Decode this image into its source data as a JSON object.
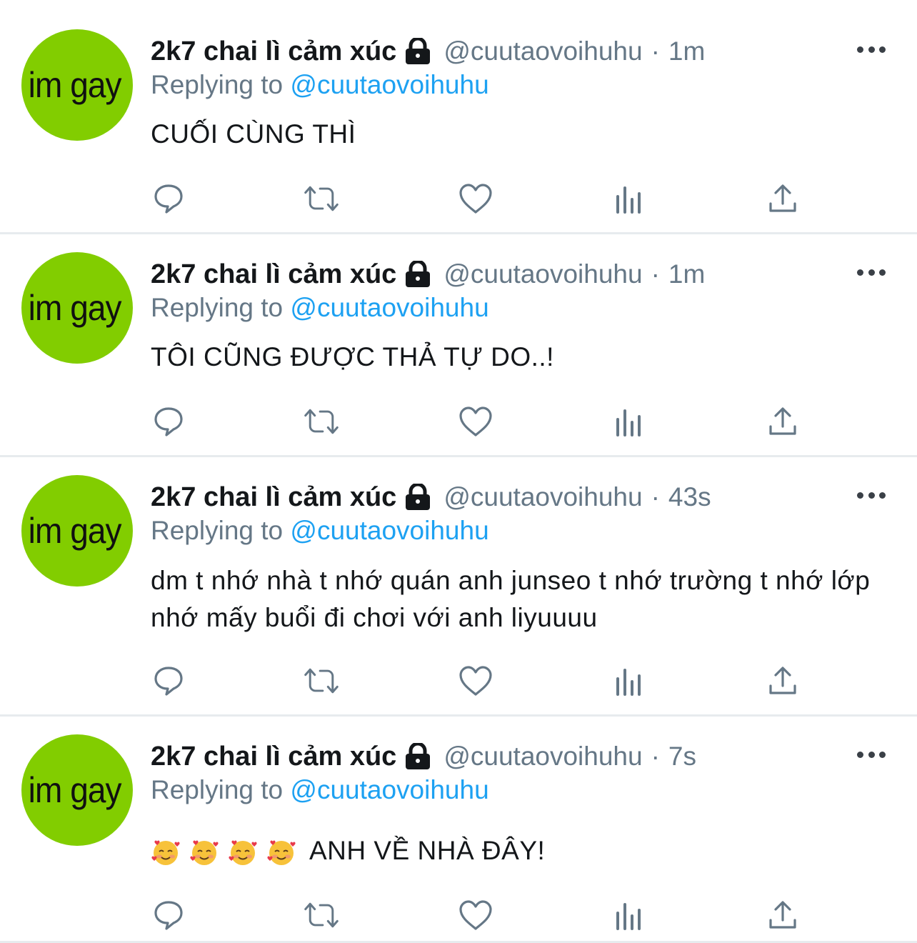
{
  "colors": {
    "avatar_bg": "#82cd00",
    "link": "#1da1f2",
    "muted": "#657786",
    "text": "#14171a"
  },
  "tweets": [
    {
      "avatar_text": "im gay",
      "name": "2k7 chai lì cảm xúc",
      "handle": "@cuutaovoihuhu",
      "dot": "·",
      "time": "1m",
      "reply_prefix": "Replying to",
      "reply_handle": "@cuutaovoihuhu",
      "text": "CUỐI CÙNG THÌ"
    },
    {
      "avatar_text": "im gay",
      "name": "2k7 chai lì cảm xúc",
      "handle": "@cuutaovoihuhu",
      "dot": "·",
      "time": "1m",
      "reply_prefix": "Replying to",
      "reply_handle": "@cuutaovoihuhu",
      "text": "TÔI CŨNG ĐƯỢC THẢ TỰ DO..!"
    },
    {
      "avatar_text": "im gay",
      "name": "2k7 chai lì cảm xúc",
      "handle": "@cuutaovoihuhu",
      "dot": "·",
      "time": "43s",
      "reply_prefix": "Replying to",
      "reply_handle": "@cuutaovoihuhu",
      "text": "dm t nhớ nhà t nhớ quán anh junseo t nhớ trường t nhớ lớp nhớ mấy buổi đi chơi với anh liyuuuu"
    },
    {
      "avatar_text": "im gay",
      "name": "2k7 chai lì cảm xúc",
      "handle": "@cuutaovoihuhu",
      "dot": "·",
      "time": "7s",
      "reply_prefix": "Replying to",
      "reply_handle": "@cuutaovoihuhu",
      "emoji": "smiling-face-with-hearts-emoji",
      "emoji_count": 4,
      "text": "ANH VỀ NHÀ ĐÂY!"
    }
  ],
  "icons": {
    "more": "more-horizontal-icon",
    "lock": "lock-icon",
    "reply": "reply-icon",
    "retweet": "retweet-icon",
    "like": "heart-icon",
    "analytics": "analytics-icon",
    "share": "share-icon"
  }
}
